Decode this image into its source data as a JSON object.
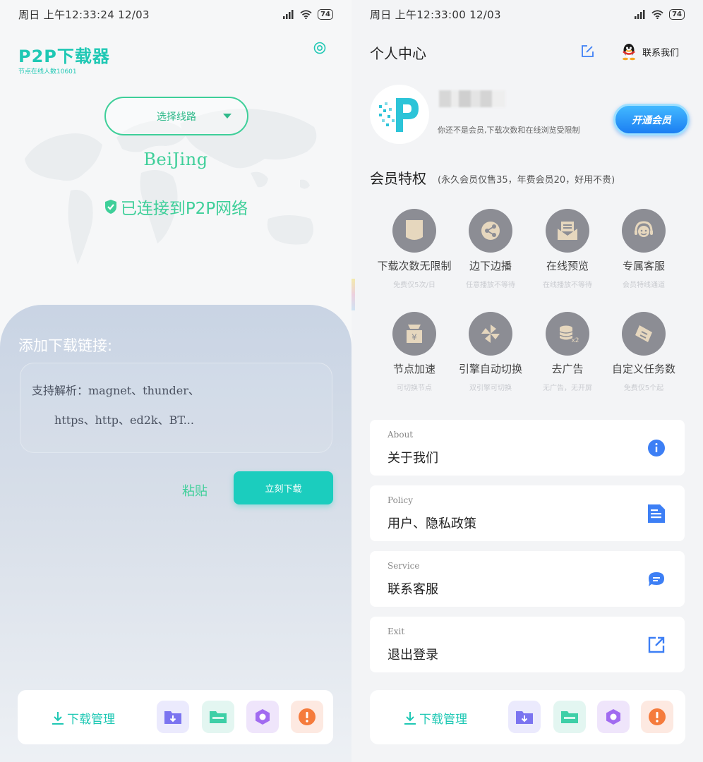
{
  "left": {
    "status": {
      "time": "周日 上午12:33:24 12/03",
      "battery": "74"
    },
    "app": {
      "title": "P2P下载器",
      "subtitle": "节点在线人数10601"
    },
    "route": {
      "label": "选择线路"
    },
    "city": "BeiJing",
    "connection": "已连接到P2P网络",
    "add_link_label": "添加下载链接:",
    "link_input": {
      "placeholder_line1": "支持解析：magnet、thunder、",
      "placeholder_line2": "https、http、ed2k、BT..."
    },
    "paste_label": "粘贴",
    "download_now_label": "立刻下载",
    "bottom_bar": {
      "manager_label": "下载管理"
    }
  },
  "right": {
    "status": {
      "time": "周日 上午12:33:00 12/03",
      "battery": "74"
    },
    "title": "个人中心",
    "contact_label": "联系我们",
    "notice": "你还不是会员,下载次数和在线浏览受限制",
    "vip_button_label": "开通会员",
    "privileges_title": "会员特权",
    "privileges_note": "(永久会员仅售35，年费会员20，好用不贵)",
    "features": [
      {
        "label": "下载次数无限制",
        "sub": "免费仅5次/日",
        "icon": "document-icon"
      },
      {
        "label": "边下边播",
        "sub": "任意播放不等待",
        "icon": "share-icon"
      },
      {
        "label": "在线预览",
        "sub": "在线播放不等待",
        "icon": "mail-icon"
      },
      {
        "label": "专属客服",
        "sub": "会员特线通道",
        "icon": "headset-icon"
      },
      {
        "label": "节点加速",
        "sub": "可切换节点",
        "icon": "coin-bag-icon"
      },
      {
        "label": "引擎自动切换",
        "sub": "双引擎可切换",
        "icon": "pinwheel-icon"
      },
      {
        "label": "去广告",
        "sub": "无广告，无开屏",
        "icon": "coins-icon"
      },
      {
        "label": "自定义任务数",
        "sub": "免费仅5个起",
        "icon": "ticket-icon"
      }
    ],
    "cards": [
      {
        "en": "About",
        "cn": "关于我们",
        "icon": "info-icon",
        "color": "#3d7ff5"
      },
      {
        "en": "Policy",
        "cn": "用户、隐私政策",
        "icon": "document-icon",
        "color": "#3d7ff5"
      },
      {
        "en": "Service",
        "cn": "联系客服",
        "icon": "chat-bubble-icon",
        "color": "#3d7ff5"
      },
      {
        "en": "Exit",
        "cn": "退出登录",
        "icon": "external-link-icon",
        "color": "#3d7ff5"
      }
    ],
    "bottom_bar": {
      "manager_label": "下载管理"
    }
  },
  "colors": {
    "accent_teal": "#1fc8b4",
    "accent_green": "#3ecf99",
    "feature_gray": "#8c8d94",
    "vip_blue": "#1c7ef2"
  },
  "bottom_icons": [
    {
      "name": "download-folder-icon",
      "bg": "#ebeafd",
      "color": "#7b74f0"
    },
    {
      "name": "folder-icon",
      "bg": "#e3f6f1",
      "color": "#3ecfa7"
    },
    {
      "name": "hexagon-icon",
      "bg": "#efe5fb",
      "color": "#a16bf0"
    },
    {
      "name": "alert-icon",
      "bg": "#fde9e1",
      "color": "#f57b3c"
    }
  ]
}
